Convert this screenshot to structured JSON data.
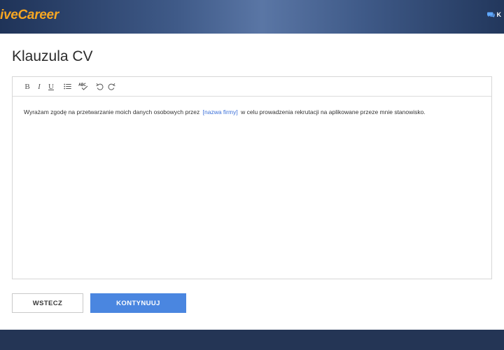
{
  "header": {
    "logo_text": "iveCareer",
    "right_label": "K",
    "icons": [
      "chat-icon"
    ]
  },
  "page": {
    "title": "Klauzula CV"
  },
  "editor": {
    "toolbar": {
      "bold": "B",
      "italic": "I",
      "underline": "U",
      "icons": [
        "list-icon",
        "spellcheck-icon",
        "undo-icon",
        "redo-icon"
      ]
    },
    "content": {
      "before": "Wyrażam zgodę na przetwarzanie moich danych osobowych przez",
      "placeholder": "[nazwa firmy]",
      "after": "w celu prowadzenia rekrutacji na aplikowane przeze mnie stanowisko."
    }
  },
  "buttons": {
    "back": "WSTECZ",
    "continue": "KONTYNUUJ"
  },
  "colors": {
    "brand_orange": "#f5a623",
    "header_dark": "#1f3358",
    "primary_blue": "#4a86e0",
    "placeholder_blue": "#3a6fd8",
    "footer": "#243555"
  }
}
